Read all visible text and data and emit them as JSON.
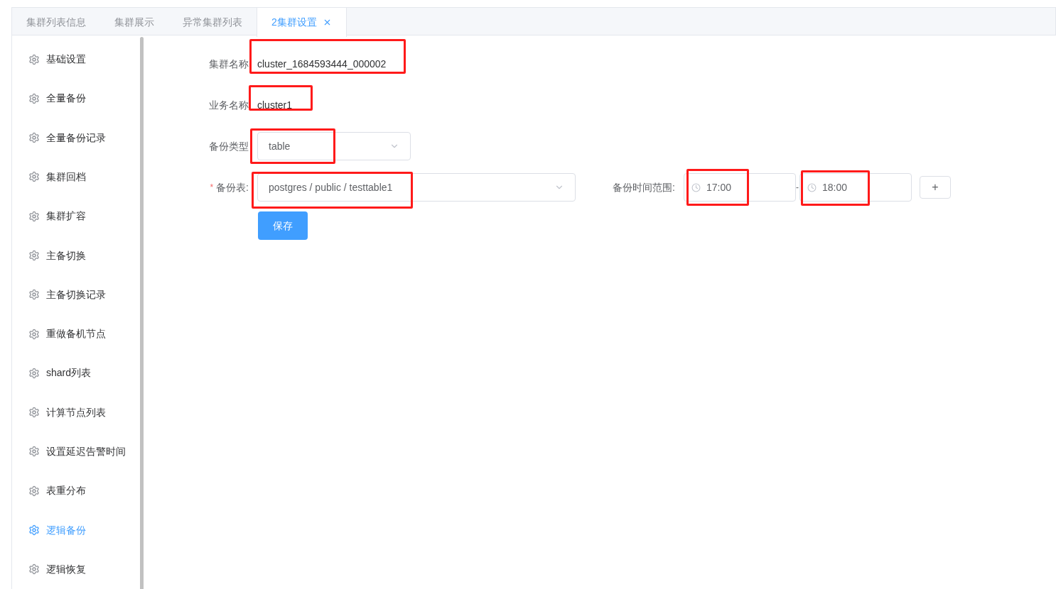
{
  "tabs": [
    {
      "label": "集群列表信息",
      "selected": false,
      "closable": false
    },
    {
      "label": "集群展示",
      "selected": false,
      "closable": false
    },
    {
      "label": "异常集群列表",
      "selected": false,
      "closable": false
    },
    {
      "label": "2集群设置",
      "selected": true,
      "closable": true
    }
  ],
  "sidebar": {
    "items": [
      {
        "label": "基础设置",
        "selected": false
      },
      {
        "label": "全量备份",
        "selected": false
      },
      {
        "label": "全量备份记录",
        "selected": false
      },
      {
        "label": "集群回档",
        "selected": false
      },
      {
        "label": "集群扩容",
        "selected": false
      },
      {
        "label": "主备切换",
        "selected": false
      },
      {
        "label": "主备切换记录",
        "selected": false
      },
      {
        "label": "重做备机节点",
        "selected": false
      },
      {
        "label": "shard列表",
        "selected": false
      },
      {
        "label": "计算节点列表",
        "selected": false
      },
      {
        "label": "设置延迟告警时间",
        "selected": false
      },
      {
        "label": "表重分布",
        "selected": false
      },
      {
        "label": "逻辑备份",
        "selected": true
      },
      {
        "label": "逻辑恢复",
        "selected": false
      }
    ]
  },
  "form": {
    "cluster_name": {
      "label": "集群名称",
      "value": "cluster_1684593444_000002",
      "highlighted": true
    },
    "business_name": {
      "label": "业务名称",
      "value": "cluster1",
      "highlighted": true
    },
    "backup_type": {
      "label": "备份类型",
      "value": "table",
      "highlighted": true
    },
    "backup_table": {
      "label": "备份表:",
      "required_mark": "*",
      "value": "postgres / public / testtable1",
      "highlighted": true
    },
    "time_range": {
      "label": "备份时间范围:",
      "start": "17:00",
      "separator": "-",
      "end": "18:00",
      "start_highlighted": true,
      "end_highlighted": true,
      "add_button": "+"
    },
    "save_button": "保存"
  }
}
